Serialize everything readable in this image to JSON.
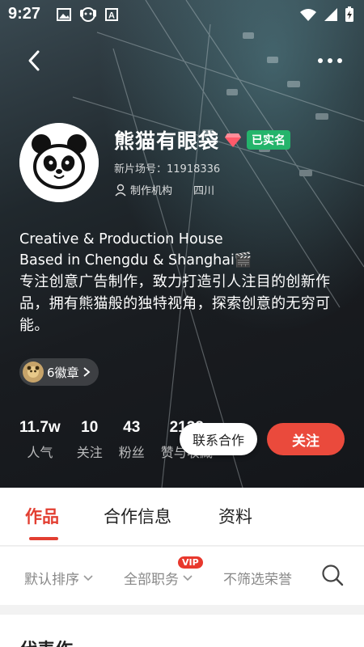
{
  "status_bar": {
    "time": "9:27"
  },
  "profile": {
    "name": "熊猫有眼袋",
    "verified_label": "已实名",
    "film_id": "新片场号：11918336",
    "role": "制作机构",
    "region": "四川",
    "bio_en_line1": "Creative & Production House",
    "bio_en_line2": "Based in Chengdu & Shanghai🎬",
    "bio_zh": "专注创意广告制作，致力打造引人注目的创新作品，拥有熊猫般的独特视角，探索创意的无穷可能。",
    "badges_label": "6徽章"
  },
  "stats": [
    {
      "value": "11.7w",
      "label": "人气"
    },
    {
      "value": "10",
      "label": "关注"
    },
    {
      "value": "43",
      "label": "粉丝"
    },
    {
      "value": "2138",
      "label": "赞与收藏"
    }
  ],
  "actions": {
    "contact_label": "联系合作",
    "follow_label": "关注"
  },
  "tabs": [
    {
      "label": "作品",
      "active": true
    },
    {
      "label": "合作信息",
      "active": false
    },
    {
      "label": "资料",
      "active": false
    }
  ],
  "filters": {
    "sort_label": "默认排序",
    "role_label": "全部职务",
    "vip_tag": "VIP",
    "honor_label": "不筛选荣誉"
  },
  "section": {
    "title": "代表作"
  },
  "colors": {
    "accent_red": "#ea4a3c",
    "verified_green": "#24b46b"
  }
}
